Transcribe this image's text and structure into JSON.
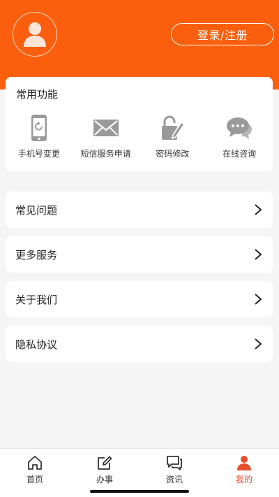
{
  "header": {
    "login_label": "登录/注册",
    "accent_color": "#fb5f0d"
  },
  "functions": {
    "title": "常用功能",
    "items": [
      {
        "label": "手机号变更",
        "icon": "phone-refresh-icon"
      },
      {
        "label": "短信服务申请",
        "icon": "envelope-icon"
      },
      {
        "label": "密码修改",
        "icon": "lock-edit-icon"
      },
      {
        "label": "在线咨询",
        "icon": "chat-bubbles-icon"
      }
    ]
  },
  "menu": [
    {
      "label": "常见问题"
    },
    {
      "label": "更多服务"
    },
    {
      "label": "关于我们"
    },
    {
      "label": "隐私协议"
    }
  ],
  "tabbar": {
    "tabs": [
      {
        "label": "首页",
        "icon": "home-icon",
        "active": false
      },
      {
        "label": "办事",
        "icon": "edit-icon",
        "active": false
      },
      {
        "label": "资讯",
        "icon": "chat-icon",
        "active": false
      },
      {
        "label": "我的",
        "icon": "person-icon",
        "active": true
      }
    ],
    "active_color": "#e44f2d"
  }
}
